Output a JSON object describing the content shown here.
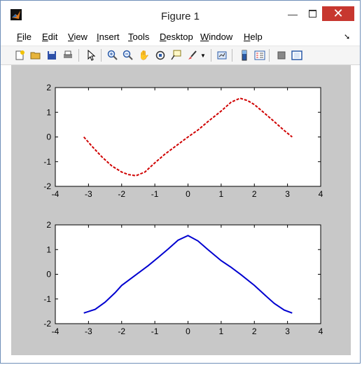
{
  "window": {
    "title": "Figure 1",
    "menu": [
      {
        "label": "File",
        "u": "F",
        "rest": "ile"
      },
      {
        "label": "Edit",
        "u": "E",
        "rest": "dit"
      },
      {
        "label": "View",
        "u": "V",
        "rest": "iew"
      },
      {
        "label": "Insert",
        "u": "I",
        "rest": "nsert"
      },
      {
        "label": "Tools",
        "u": "T",
        "rest": "ools"
      },
      {
        "label": "Desktop",
        "u": "D",
        "rest": "esktop"
      },
      {
        "label": "Window",
        "u": "W",
        "rest": "indow"
      },
      {
        "label": "Help",
        "u": "H",
        "rest": "elp"
      }
    ],
    "toolbar_icons": [
      "new-figure-icon",
      "open-file-icon",
      "save-icon",
      "print-icon",
      "edit-plot-arrow-icon",
      "zoom-in-icon",
      "zoom-out-icon",
      "pan-hand-icon",
      "rotate-3d-icon",
      "data-cursor-icon",
      "brush-icon",
      "brush-dropdown-icon",
      "link-plot-icon",
      "insert-colorbar-icon",
      "insert-legend-icon",
      "hide-plot-tools-icon",
      "show-plot-tools-icon"
    ]
  },
  "colors": {
    "series1": "#d00000",
    "series2": "#0000d0",
    "figure_bg": "#c8c8c8",
    "close_btn": "#c7372f"
  },
  "chart_data": [
    {
      "type": "line",
      "xlim": [
        -4,
        4
      ],
      "ylim": [
        -2,
        2
      ],
      "xticks": [
        -4,
        -3,
        -2,
        -1,
        0,
        1,
        2,
        3,
        4
      ],
      "yticks": [
        -2,
        -1,
        0,
        1,
        2
      ],
      "line_style": "dashed",
      "series": [
        {
          "color": "#d00000",
          "x": [
            -3.14,
            -2.9,
            -2.6,
            -2.3,
            -2.0,
            -1.8,
            -1.57,
            -1.3,
            -1.0,
            -0.7,
            -0.4,
            0.0,
            0.3,
            0.6,
            1.0,
            1.3,
            1.57,
            1.8,
            2.0,
            2.3,
            2.6,
            2.9,
            3.14
          ],
          "y": [
            0.0,
            -0.37,
            -0.8,
            -1.17,
            -1.42,
            -1.52,
            -1.57,
            -1.42,
            -1.05,
            -0.7,
            -0.4,
            0.0,
            0.28,
            0.62,
            1.05,
            1.41,
            1.57,
            1.47,
            1.31,
            0.97,
            0.62,
            0.26,
            0.0
          ]
        }
      ]
    },
    {
      "type": "line",
      "xlim": [
        -4,
        4
      ],
      "ylim": [
        -2,
        2
      ],
      "xticks": [
        -4,
        -3,
        -2,
        -1,
        0,
        1,
        2,
        3,
        4
      ],
      "yticks": [
        -2,
        -1,
        0,
        1,
        2
      ],
      "line_style": "solid",
      "series": [
        {
          "color": "#0000d0",
          "x": [
            -3.14,
            -2.8,
            -2.5,
            -2.2,
            -2.0,
            -1.6,
            -1.2,
            -0.9,
            -0.6,
            -0.3,
            0.0,
            0.3,
            0.6,
            1.0,
            1.3,
            1.6,
            2.0,
            2.3,
            2.6,
            2.9,
            3.14
          ],
          "y": [
            -1.57,
            -1.42,
            -1.13,
            -0.75,
            -0.45,
            -0.05,
            0.35,
            0.68,
            1.02,
            1.38,
            1.57,
            1.35,
            1.0,
            0.55,
            0.28,
            -0.02,
            -0.45,
            -0.82,
            -1.18,
            -1.45,
            -1.57
          ]
        }
      ]
    }
  ]
}
